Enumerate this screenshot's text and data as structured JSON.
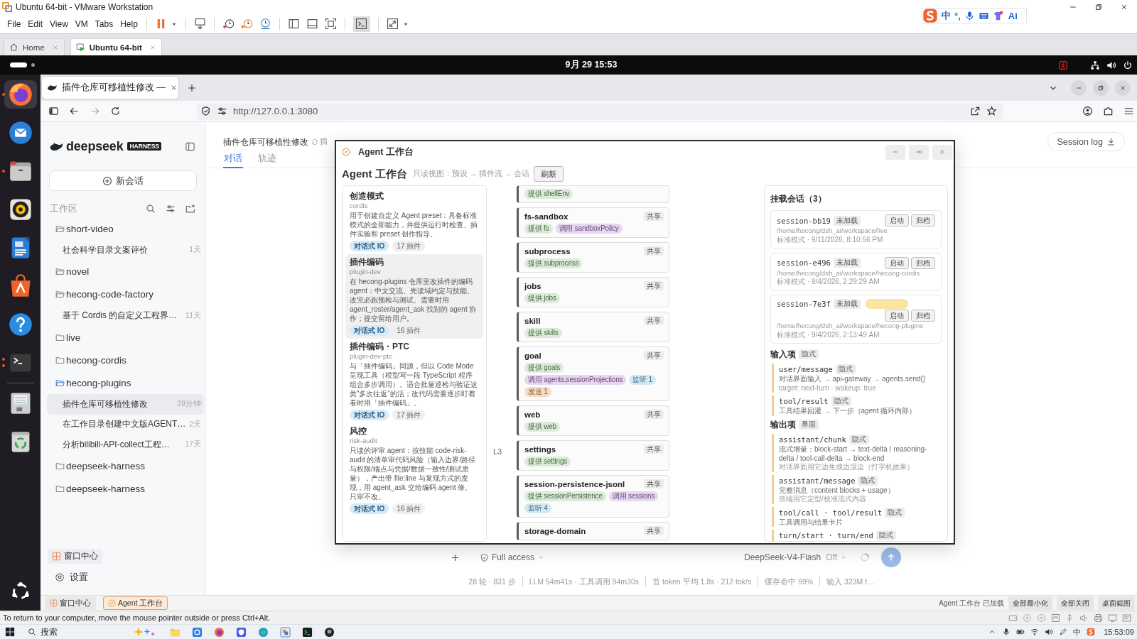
{
  "vmware": {
    "title": "Ubuntu 64-bit - VMware Workstation",
    "menu": [
      "File",
      "Edit",
      "View",
      "VM",
      "Tabs",
      "Help"
    ],
    "console_view_on": true,
    "tabs": [
      {
        "label": "Home",
        "selected": false
      },
      {
        "label": "Ubuntu 64-bit",
        "selected": true
      }
    ]
  },
  "ime_toolbar": {
    "mode": "中",
    "punctuation": "°,",
    "assistant": "Ai"
  },
  "ubuntu": {
    "clock": "9月 29 15:53",
    "dock_pinned": [
      {
        "kind": "firefox",
        "running": true,
        "focused": true,
        "multiple_windows": false
      },
      {
        "kind": "thunderbird",
        "running": false,
        "focused": false,
        "multiple_windows": false
      },
      {
        "kind": "files",
        "running": true,
        "focused": false,
        "multiple_windows": false
      },
      {
        "kind": "rhythmbox",
        "running": false,
        "focused": false,
        "multiple_windows": false
      },
      {
        "kind": "writer",
        "running": false,
        "focused": false,
        "multiple_windows": false
      },
      {
        "kind": "appcenter",
        "running": false,
        "focused": false,
        "multiple_windows": false
      },
      {
        "kind": "help",
        "running": false,
        "focused": false,
        "multiple_windows": false
      },
      {
        "kind": "terminal",
        "running": true,
        "focused": false,
        "multiple_windows": true
      }
    ],
    "dock_other": [
      {
        "kind": "disk",
        "running": false,
        "focused": false,
        "multiple_windows": false
      },
      {
        "kind": "trash",
        "running": false,
        "focused": false,
        "multiple_windows": false
      }
    ]
  },
  "browser": {
    "tab_title": "插件仓库可移植性修改 —",
    "url": "http://127.0.0.1:3080"
  },
  "app": {
    "brand": "deepseek",
    "brand_badge": "HARNESS",
    "new_chat": "新会话",
    "workspace_label": "工作区",
    "workspaces": [
      {
        "name": "short-video",
        "expanded": true,
        "active": false,
        "children": [
          {
            "title": "社会科学目录文案评价",
            "age": "1天",
            "selected": false
          }
        ]
      },
      {
        "name": "novel",
        "expanded": true,
        "active": false
      },
      {
        "name": "hecong-code-factory",
        "expanded": true,
        "active": false,
        "children": [
          {
            "title": "基于 Cordis 的自定义工程界…",
            "age": "11天",
            "selected": false
          }
        ]
      },
      {
        "name": "live",
        "expanded": false,
        "active": false
      },
      {
        "name": "hecong-cordis",
        "expanded": false,
        "active": false
      },
      {
        "name": "hecong-plugins",
        "expanded": true,
        "active": true,
        "children": [
          {
            "title": "插件仓库可移植性修改",
            "age": "28分钟",
            "selected": true
          },
          {
            "title": "在工作目录创建中文版AGENT…",
            "age": "2天",
            "selected": false
          },
          {
            "title": "分析bilibili-API-collect工程…",
            "age": "17天",
            "selected": false
          }
        ]
      },
      {
        "name": "deepseek-harness",
        "expanded": false,
        "active": false
      },
      {
        "name": "deepseek-harness",
        "expanded": false,
        "active": false
      }
    ],
    "window_center": "窗口中心",
    "settings": "设置",
    "header": {
      "title": "插件仓库可移植性修改",
      "partial_label": "插",
      "tabs": [
        {
          "label": "对话",
          "selected": true
        },
        {
          "label": "轨迹",
          "selected": false
        }
      ],
      "session_log": "Session log"
    },
    "composer": {
      "access": "Full access",
      "model": "DeepSeek-V4-Flash",
      "model_mode": "Off"
    },
    "stats": [
      "28 轮 · 831 步",
      "LLM 54m41s · 工具调用 94m30s",
      "首 token 平均 1.8s · 212 tok/s",
      "缓存命中 99%",
      "输入 323M t…"
    ]
  },
  "workbench": {
    "window_title": "Agent 工作台",
    "heading": "Agent 工作台",
    "subtitle": "只读视图：预设 → 插件流 → 会话",
    "refresh": "刷新",
    "presets": [
      {
        "title": "创造模式",
        "slug": "cordis",
        "description": "用于创建自定义 Agent preset：具备标准模式的全部能力，并提供运行时检查、插件实验和 preset 创作指导。",
        "mode": "对话式 IO",
        "plugin_count": "17 插件",
        "selected": false
      },
      {
        "title": "插件编码",
        "slug": "plugin-dev",
        "description": "在 hecong-plugins 仓库里改插件的编码 agent：中文交流、先读域约定与技能、改完必跑预检与测试、需要时用 agent_roster/agent_ask 找别的 agent 协作；提交留给用户。",
        "mode": "对话式 IO",
        "plugin_count": "16 插件",
        "selected": true
      },
      {
        "title": "插件编码・PTC",
        "slug": "plugin-dev-ptc",
        "description": "与「插件编码」同源，但以 Code Mode 呈现工具（模型写一段 TypeScript 程序组合多步调用）。适合批量巡检与验证这类“多次往返”的活；改代码需要逐步盯着看时用「插件编码」。",
        "mode": "对话式 IO",
        "plugin_count": "17 插件",
        "selected": false
      },
      {
        "title": "风控",
        "slug": "risk-audit",
        "description": "只读的评审 agent：按技能 code-risk-audit 的清单审代码风险（输入边界/路径与权限/端点与凭据/数据一致性/测试质量），产出带 file:line 与复现方式的发现，用 agent_ask 交给编码 agent 修。只审不改。",
        "mode": "对话式 IO",
        "plugin_count": "16 插件",
        "selected": false
      }
    ],
    "plugin_groups": [
      {
        "plugins": [
          {
            "tags": [
              {
                "kind": "provide",
                "text": "提供 shellEnv"
              }
            ]
          },
          {
            "name": "fs-sandbox",
            "scope": "共享",
            "tags": [
              {
                "kind": "provide",
                "text": "提供 fs"
              },
              {
                "kind": "call",
                "text": "调用 sandboxPolicy"
              }
            ]
          },
          {
            "name": "subprocess",
            "scope": "共享",
            "tags": [
              {
                "kind": "provide",
                "text": "提供 subprocess"
              }
            ]
          },
          {
            "name": "jobs",
            "scope": "共享",
            "tags": [
              {
                "kind": "provide",
                "text": "提供 jobs"
              }
            ]
          },
          {
            "name": "skill",
            "scope": "共享",
            "tags": [
              {
                "kind": "provide",
                "text": "提供 skills"
              }
            ]
          },
          {
            "name": "goal",
            "scope": "共享",
            "tags": [
              {
                "kind": "provide",
                "text": "提供 goals"
              },
              {
                "kind": "call",
                "text": "调用 agents,sessionProjections"
              },
              {
                "kind": "listen",
                "text": "监听 1"
              },
              {
                "kind": "send",
                "text": "发送 1"
              }
            ]
          },
          {
            "name": "web",
            "scope": "共享",
            "tags": [
              {
                "kind": "provide",
                "text": "提供 web"
              }
            ]
          }
        ]
      },
      {
        "layer": "L3",
        "plugins": [
          {
            "name": "settings",
            "scope": "共享",
            "tags": [
              {
                "kind": "provide",
                "text": "提供 settings"
              }
            ]
          },
          {
            "name": "session-persistence-jsonl",
            "scope": "共享",
            "tags": [
              {
                "kind": "provide",
                "text": "提供 sessionPersistence"
              },
              {
                "kind": "call",
                "text": "调用 sessions"
              },
              {
                "kind": "listen",
                "text": "监听 4"
              }
            ]
          },
          {
            "name": "storage-domain",
            "scope": "共享"
          }
        ]
      }
    ],
    "sessions_title": "挂载会话（3）",
    "sessions": [
      {
        "name": "session-bb19",
        "status": "未加载",
        "current": false,
        "actions": [
          "启动",
          "归档"
        ],
        "path": "/home/hecong/dsh_ai/workspace/live",
        "meta": "标准模式 · 9/11/2026, 8:10:56 PM"
      },
      {
        "name": "session-e496",
        "status": "未加载",
        "current": false,
        "actions": [
          "启动",
          "归档"
        ],
        "path": "/home/hecong/dsh_ai/workspace/hecong-cordis",
        "meta": "标准模式 · 9/4/2026, 2:29:29 AM"
      },
      {
        "name": "session-7e3f",
        "status": "未加载",
        "current": true,
        "actions": [
          "启动",
          "归档"
        ],
        "path": "/home/hecong/dsh_ai/workspace/hecong-plugins",
        "meta": "标准模式 · 9/4/2026, 2:13:49 AM"
      }
    ],
    "io_sections": [
      {
        "title": "输入项",
        "badge": "隐式",
        "items": [
          {
            "name": "user/message",
            "badge": "隐式",
            "description": "对话界面输入 → api-gateway → agents.send()",
            "note": "target: next-turn · wakeup: true"
          },
          {
            "name": "tool/result",
            "badge": "隐式",
            "description": "工具结果回灌 → 下一步（agent 循环内部）"
          }
        ]
      },
      {
        "title": "输出项",
        "badge": "界面",
        "items": [
          {
            "name": "assistant/chunk",
            "badge": "隐式",
            "description": "流式增量：block-start → text-delta / reasoning-delta / tool-call-delta → block-end",
            "note": "对话界面用它边生成边渲染（打字机效果）"
          },
          {
            "name": "assistant/message",
            "badge": "隐式",
            "description": "完整消息（content blocks + usage）",
            "note": "前端用它定型/校准流式内容"
          },
          {
            "name": "tool/call · tool/result",
            "badge": "隐式",
            "description": "工具调用与结果卡片"
          },
          {
            "name": "turn/start · turn/end",
            "badge": "隐式"
          }
        ]
      }
    ]
  },
  "app_taskbar": {
    "windows": [
      {
        "label": "窗口中心",
        "selected": false
      },
      {
        "label": "Agent 工作台",
        "selected": true
      }
    ],
    "status": "Agent 工作台 已加载",
    "actions": [
      "全部最小化",
      "全部关闭",
      "桌面截图"
    ]
  },
  "vmware_status": {
    "message": "To return to your computer, move the mouse pointer outside or press Ctrl+Alt."
  },
  "windows_taskbar": {
    "search": "搜索",
    "input_mode": "中",
    "time": "15:53:09"
  }
}
